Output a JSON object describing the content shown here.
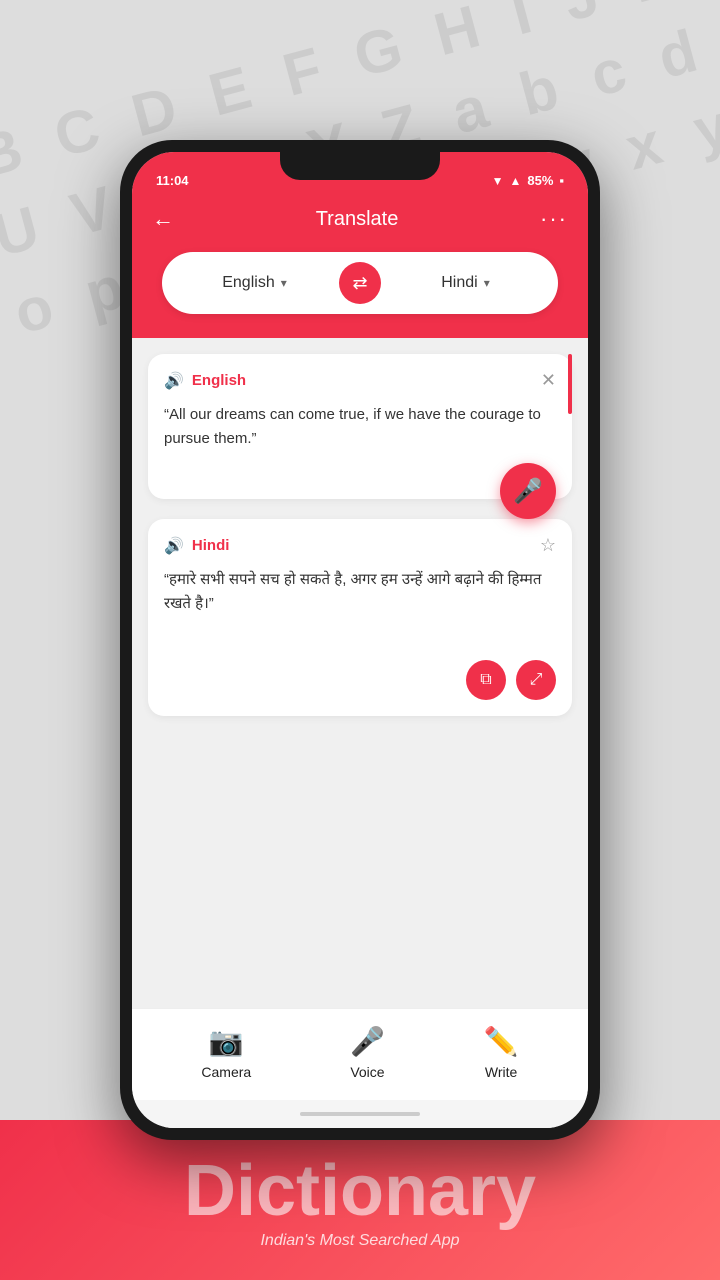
{
  "status": {
    "time": "11:04",
    "battery": "85%"
  },
  "header": {
    "title": "Translate",
    "back_label": "←",
    "menu_label": "···"
  },
  "lang_selector": {
    "source_lang": "English",
    "target_lang": "Hindi",
    "arrow": "▾",
    "translate_icon": "🔄"
  },
  "source_card": {
    "lang_label": "English",
    "close_icon": "✕",
    "text": "“All our dreams can come true, if we have the courage to pursue them.”"
  },
  "target_card": {
    "lang_label": "Hindi",
    "star_icon": "☆",
    "text": "“हमारे सभी सपने सच हो सकते है, अगर हम उन्हें आगे बढ़ाने की हिम्मत रखते है।”"
  },
  "toolbar": {
    "camera_label": "Camera",
    "voice_label": "Voice",
    "write_label": "Write"
  },
  "branding": {
    "title": "Dictionary",
    "subtitle": "Indian's Most Searched App"
  }
}
